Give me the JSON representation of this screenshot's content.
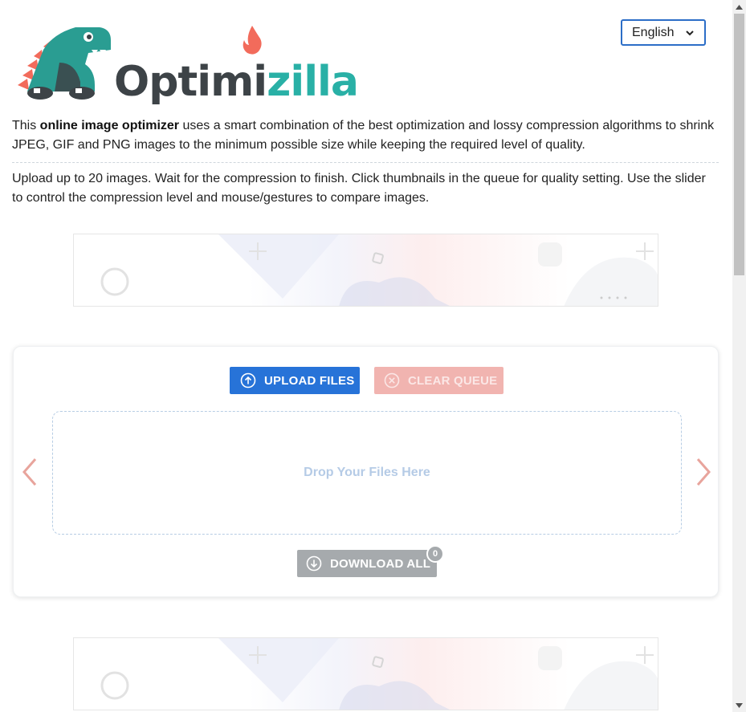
{
  "brand": {
    "name_part1": "Optimi",
    "name_part2": "zilla",
    "colors": {
      "dark": "#3d4347",
      "teal": "#29b0a6",
      "flame": "#f26b5b",
      "dino": "#2a9d92"
    }
  },
  "language_select": {
    "value": "English",
    "icon": "chevron-down-icon"
  },
  "intro": {
    "prefix": "This ",
    "bold": "online image optimizer",
    "suffix": " uses a smart combination of the best optimization and lossy compression algorithms to shrink JPEG, GIF and PNG images to the minimum possible size while keeping the required level of quality."
  },
  "instructions": "Upload up to 20 images. Wait for the compression to finish. Click thumbnails in the queue for quality setting. Use the slider to control the compression level and mouse/gestures to compare images.",
  "uploader": {
    "upload_label": "UPLOAD FILES",
    "upload_icon": "arrow-up-circle-icon",
    "clear_label": "CLEAR QUEUE",
    "clear_icon": "x-circle-icon",
    "drop_text": "Drop Your Files Here",
    "download_label": "DOWNLOAD ALL",
    "download_icon": "arrow-down-circle-icon",
    "download_count": "0",
    "prev_icon": "chevron-left-icon",
    "next_icon": "chevron-right-icon",
    "colors": {
      "primary": "#2773d8",
      "clear_disabled": "#f1b4b0",
      "download_disabled": "#a6aaad",
      "arrows": "#e8a49c"
    }
  }
}
